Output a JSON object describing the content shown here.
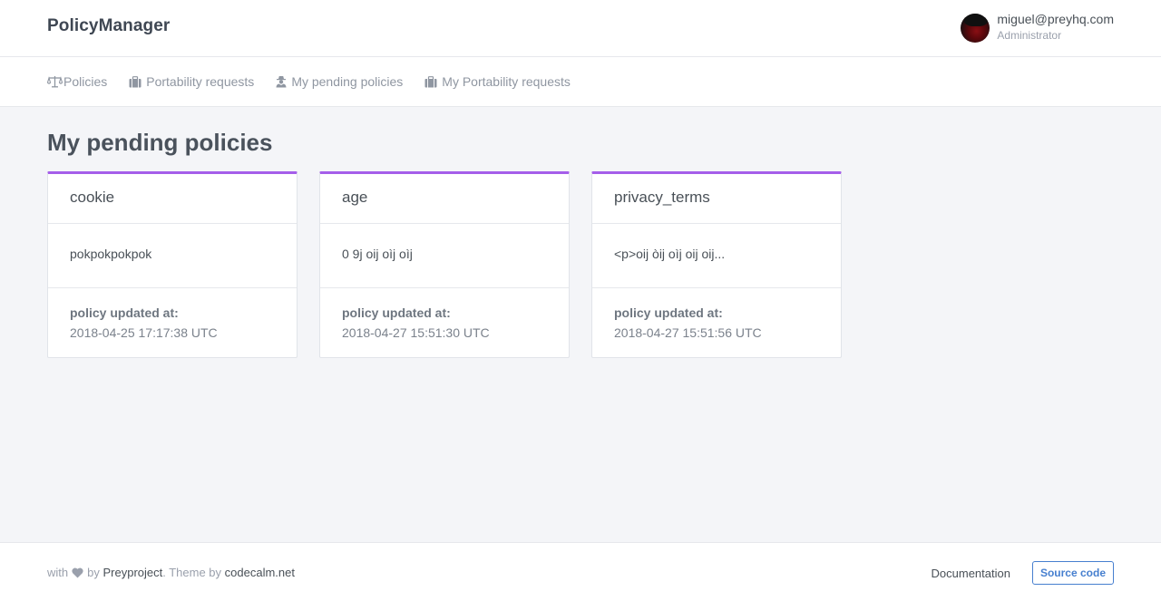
{
  "app": {
    "brand": "PolicyManager"
  },
  "user": {
    "email": "miguel@preyhq.com",
    "role": "Administrator"
  },
  "nav": {
    "items": [
      {
        "label": "Policies",
        "icon": "scale-icon"
      },
      {
        "label": "Portability requests",
        "icon": "briefcase-icon"
      },
      {
        "label": "My pending policies",
        "icon": "user-secret-icon"
      },
      {
        "label": "My Portability requests",
        "icon": "briefcase-icon"
      }
    ]
  },
  "main": {
    "title": "My pending policies",
    "accent_color": "#a55eea",
    "cards": [
      {
        "title": "cookie",
        "body": "pokpokpokpok",
        "footer_label": "policy updated at:",
        "updated_at": "2018-04-25 17:17:38 UTC"
      },
      {
        "title": "age",
        "body": "0 9j oij oìj oìj",
        "footer_label": "policy updated at:",
        "updated_at": "2018-04-27 15:51:30 UTC"
      },
      {
        "title": "privacy_terms",
        "body": "<p>oij òij oìj oij oij...",
        "footer_label": "policy updated at:",
        "updated_at": "2018-04-27 15:51:56 UTC"
      }
    ]
  },
  "footer": {
    "with_text": "with",
    "by_text": "by",
    "preyproject": "Preyproject",
    "theme_by": ". Theme by",
    "codecalm": "codecalm.net",
    "documentation": "Documentation",
    "source_code": "Source code"
  }
}
